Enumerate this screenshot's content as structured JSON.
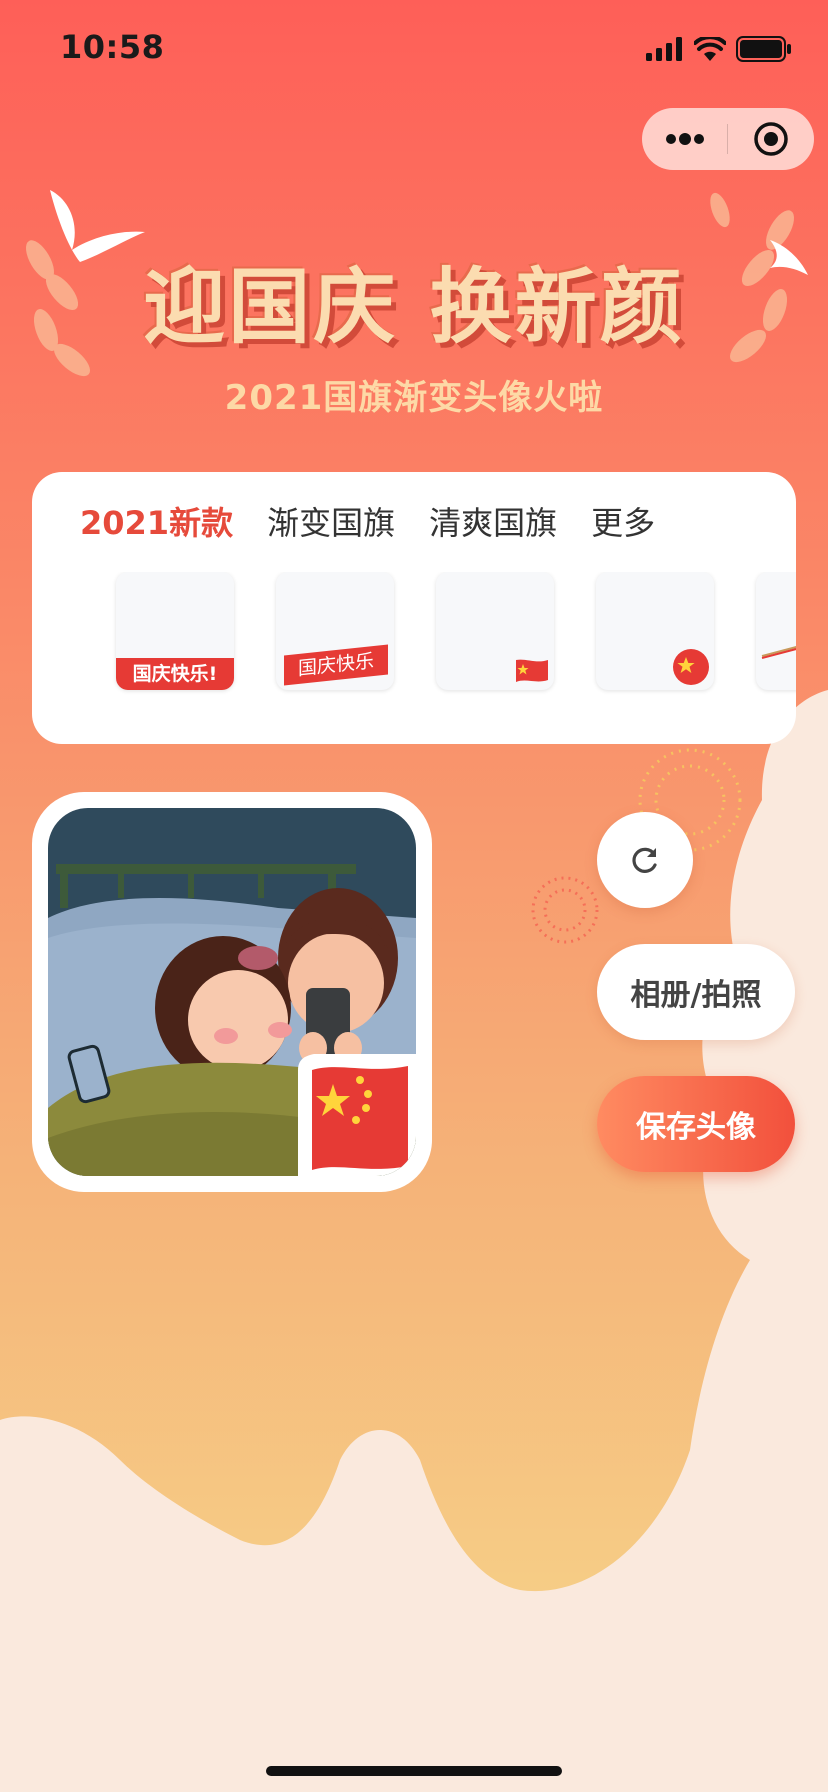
{
  "status_bar": {
    "time": "10:58"
  },
  "capsule": {
    "more_icon": "more-dots-icon",
    "close_icon": "target-close-icon"
  },
  "banner": {
    "headline": "迎国庆 换新颜",
    "subtitle": "2021国旗渐变头像火啦"
  },
  "tabs": [
    {
      "label": "2021新款",
      "active": true
    },
    {
      "label": "渐变国旗",
      "active": false
    },
    {
      "label": "清爽国旗",
      "active": false
    },
    {
      "label": "更多",
      "active": false
    }
  ],
  "frames": [
    {
      "label": "国庆快乐!"
    },
    {
      "label": "国庆快乐"
    },
    {
      "label": ""
    },
    {
      "label": ""
    },
    {
      "label": ""
    }
  ],
  "actions": {
    "album_label": "相册/拍照",
    "save_label": "保存头像"
  },
  "colors": {
    "accent": "#e64a3b",
    "bg_top": "#fe625a",
    "bg_bottom": "#f7d28a",
    "cream": "#fae9dd"
  }
}
